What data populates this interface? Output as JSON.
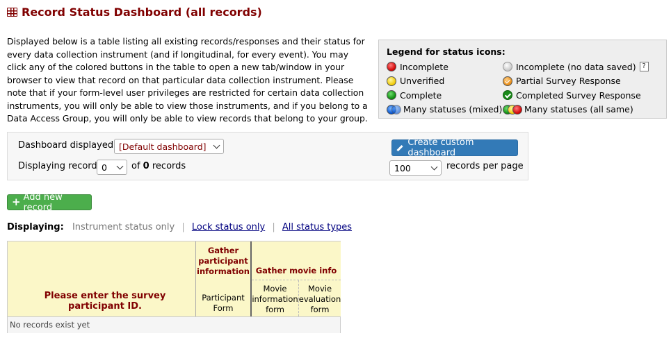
{
  "page": {
    "title": "Record Status Dashboard (all records)",
    "description": "Displayed below is a table listing all existing records/responses and their status for every data collection instrument (and if longitudinal, for every event). You may click any of the colored buttons in the table to open a new tab/window in your browser to view that record on that particular data collection instrument. Please note that if your form-level user privileges are restricted for certain data collection instruments, you will only be able to view those instruments, and if you belong to a Data Access Group, you will only be able to view records that belong to your group."
  },
  "legend": {
    "title": "Legend for status icons:",
    "left": [
      {
        "label": "Incomplete",
        "icon": "red"
      },
      {
        "label": "Unverified",
        "icon": "yellow"
      },
      {
        "label": "Complete",
        "icon": "green"
      },
      {
        "label": "Many statuses (mixed)",
        "icon": "blue"
      }
    ],
    "right": [
      {
        "label": "Incomplete (no data saved)",
        "icon": "gray"
      },
      {
        "label": "Partial Survey Response",
        "icon": "orange-check"
      },
      {
        "label": "Completed Survey Response",
        "icon": "green-check"
      },
      {
        "label": "Many statuses (all same)",
        "icon": "green-yellow-red"
      }
    ],
    "help_label": "?"
  },
  "controls": {
    "dashboard_label": "Dashboard displayed:",
    "dashboard_value": "[Default dashboard]",
    "create_button": "Create custom dashboard",
    "displaying_label": "Displaying record",
    "record_select_value": "0",
    "of_text": "of",
    "record_count": "0",
    "records_text": "records",
    "per_page_value": "100",
    "per_page_label": "records per page"
  },
  "add_record_button": "Add new record",
  "display_mode": {
    "label": "Displaying:",
    "current": "Instrument status only",
    "links": [
      "Lock status only",
      "All status types"
    ]
  },
  "table": {
    "id_header": "Please enter the survey participant ID.",
    "groups": [
      {
        "name": "Gather participant information",
        "forms": [
          "Participant Form"
        ]
      },
      {
        "name": "Gather movie info",
        "forms": [
          "Movie information form",
          "Movie evaluation form"
        ]
      }
    ],
    "empty_text": "No records exist yet"
  },
  "colors": {
    "title": "#800000",
    "legend_bg": "#eeeeee",
    "table_header_bg": "#fbf7c8",
    "primary_button": "#337ab7",
    "success_button": "#4cae4c"
  }
}
